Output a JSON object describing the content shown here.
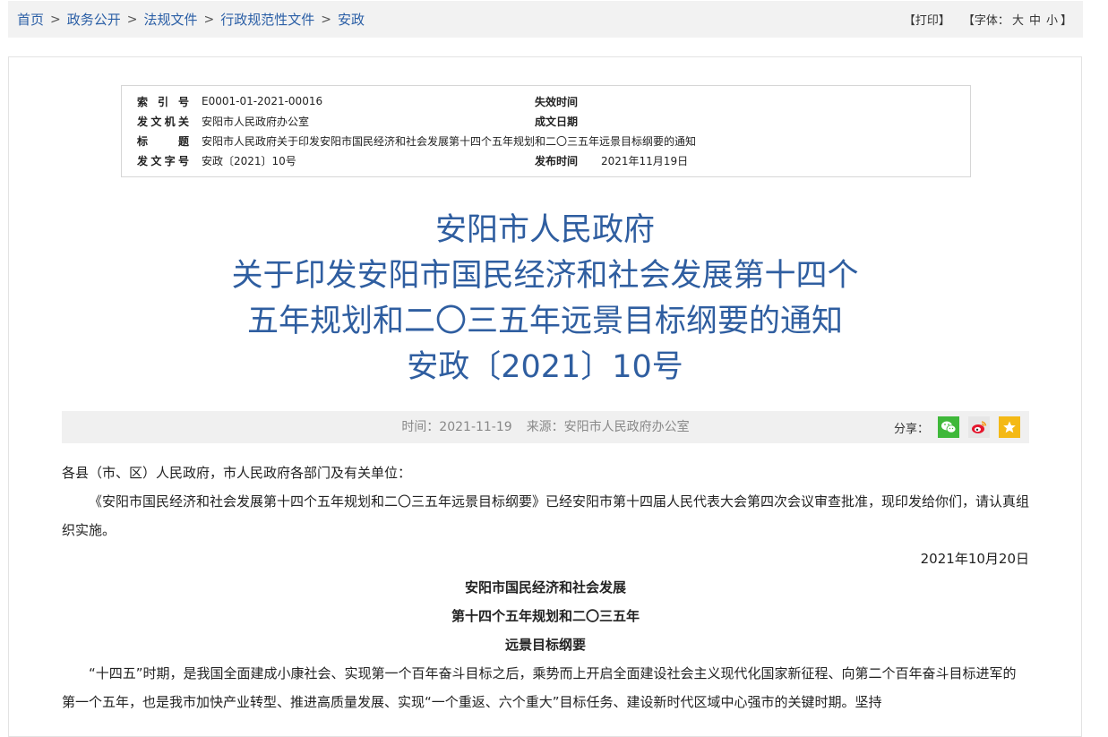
{
  "breadcrumb": {
    "items": [
      "首页",
      "政务公开",
      "法规文件",
      "行政规范性文件",
      "安政"
    ],
    "separator": ">"
  },
  "tools": {
    "print": "【打印】",
    "font_prefix": "【字体：",
    "font_large": "大",
    "font_medium": "中",
    "font_small": "小",
    "font_suffix": "】"
  },
  "meta": {
    "index_label": "索 引 号",
    "index_value": "E0001-01-2021-00016",
    "expire_label": "失效时间",
    "expire_value": "",
    "issuer_label": "发文机关",
    "issuer_value": "安阳市人民政府办公室",
    "created_label": "成文日期",
    "created_value": "",
    "title_label": "标 题",
    "title_value": "安阳市人民政府关于印发安阳市国民经济和社会发展第十四个五年规划和二〇三五年远景目标纲要的通知",
    "docno_label": "发文字号",
    "docno_value": "安政〔2021〕10号",
    "publish_label": "发布时间",
    "publish_value": "2021年11月19日"
  },
  "title_lines": [
    "安阳市人民政府",
    "关于印发安阳市国民经济和社会发展第十四个",
    "五年规划和二〇三五年远景目标纲要的通知",
    "安政〔2021〕10号"
  ],
  "info": {
    "time": "时间：2021-11-19",
    "source": "来源：安阳市人民政府办公室",
    "share_label": "分享："
  },
  "body": {
    "salutation": "各县（市、区）人民政府，市人民政府各部门及有关单位：",
    "para1": "《安阳市国民经济和社会发展第十四个五年规划和二〇三五年远景目标纲要》已经安阳市第十四届人民代表大会第四次会议审查批准，现印发给你们，请认真组织实施。",
    "date": "2021年10月20日",
    "heading1": "安阳市国民经济和社会发展",
    "heading2": "第十四个五年规划和二〇三五年",
    "heading3": "远景目标纲要",
    "para2": "“十四五”时期，是我国全面建成小康社会、实现第一个百年奋斗目标之后，乘势而上开启全面建设社会主义现代化国家新征程、向第二个百年奋斗目标进军的第一个五年，也是我市加快产业转型、推进高质量发展、实现“一个重返、六个重大”目标任务、建设新时代区域中心强市的关键时期。坚持"
  },
  "colors": {
    "link": "#2b5fa6",
    "title": "#2f5ea0",
    "wechat": "#3fb83a",
    "weibo": "#e6162d",
    "star": "#f4b916"
  },
  "icons": [
    "wechat-icon",
    "weibo-icon",
    "favorite-star-icon"
  ]
}
